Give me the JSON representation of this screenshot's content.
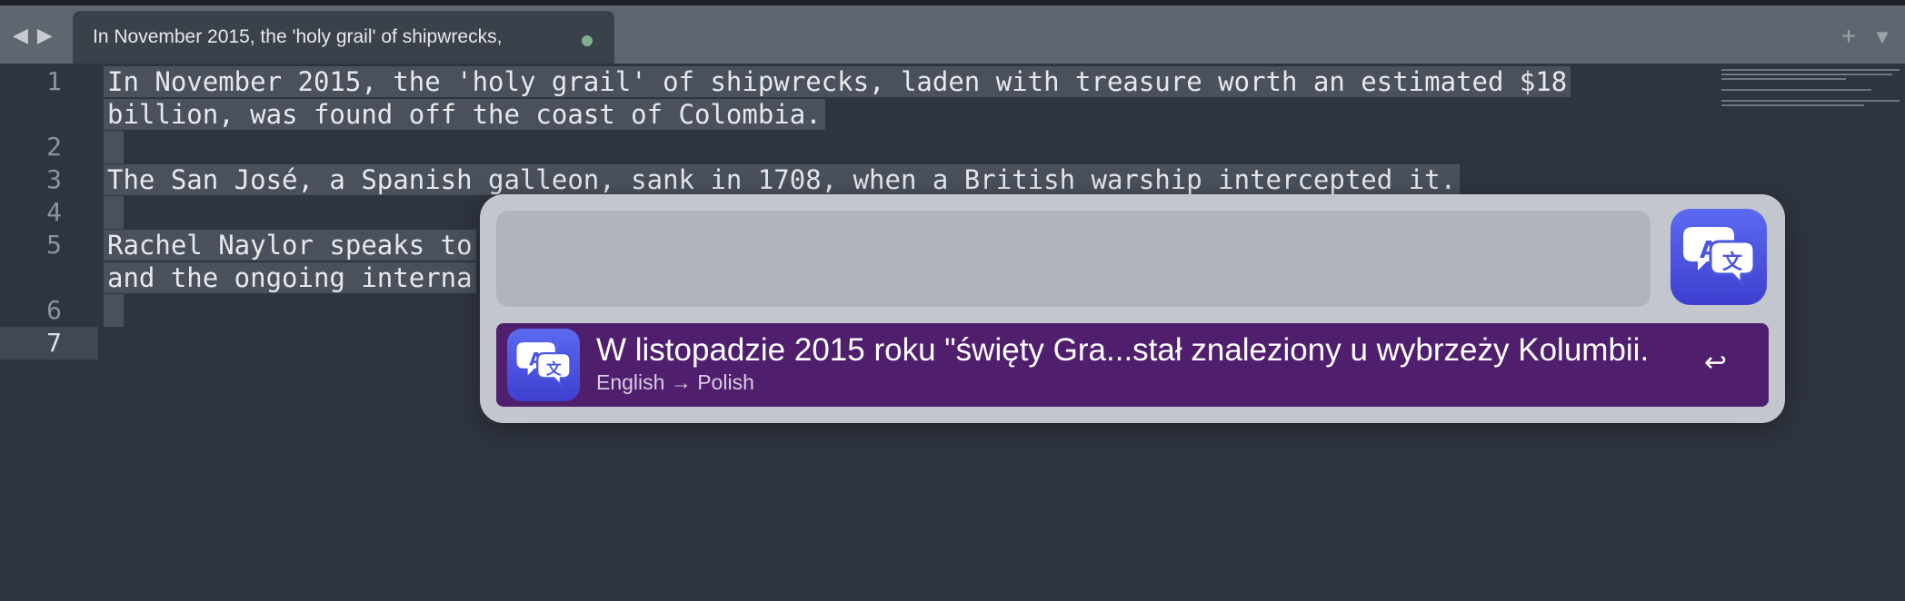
{
  "window": {
    "tab_title": "In November 2015, the 'holy grail' of shipwrecks,",
    "nav_back": "◀",
    "nav_forward": "▶",
    "add_tab": "+",
    "menu": "▼"
  },
  "editor": {
    "line_numbers": [
      "1",
      "2",
      "3",
      "4",
      "5",
      "6",
      "7"
    ],
    "lines": [
      "In November 2015, the 'holy grail' of shipwrecks, laden with treasure worth an estimated $18",
      "billion, was found off the coast of Colombia.",
      "The San José, a Spanish galleon, sank in 1708, when a British warship intercepted it.",
      "Rachel Naylor speaks to",
      "and the ongoing interna"
    ],
    "active_line": "7"
  },
  "launcher": {
    "query": "",
    "result": {
      "title": "W listopadzie 2015 roku \"święty Gra...stał znaleziony u wybrzeży Kolumbii.",
      "subtitle": "English → Polish",
      "action_icon": "↩"
    },
    "icon_name": "translate-icon",
    "accent_color": "#4f1f6e"
  }
}
